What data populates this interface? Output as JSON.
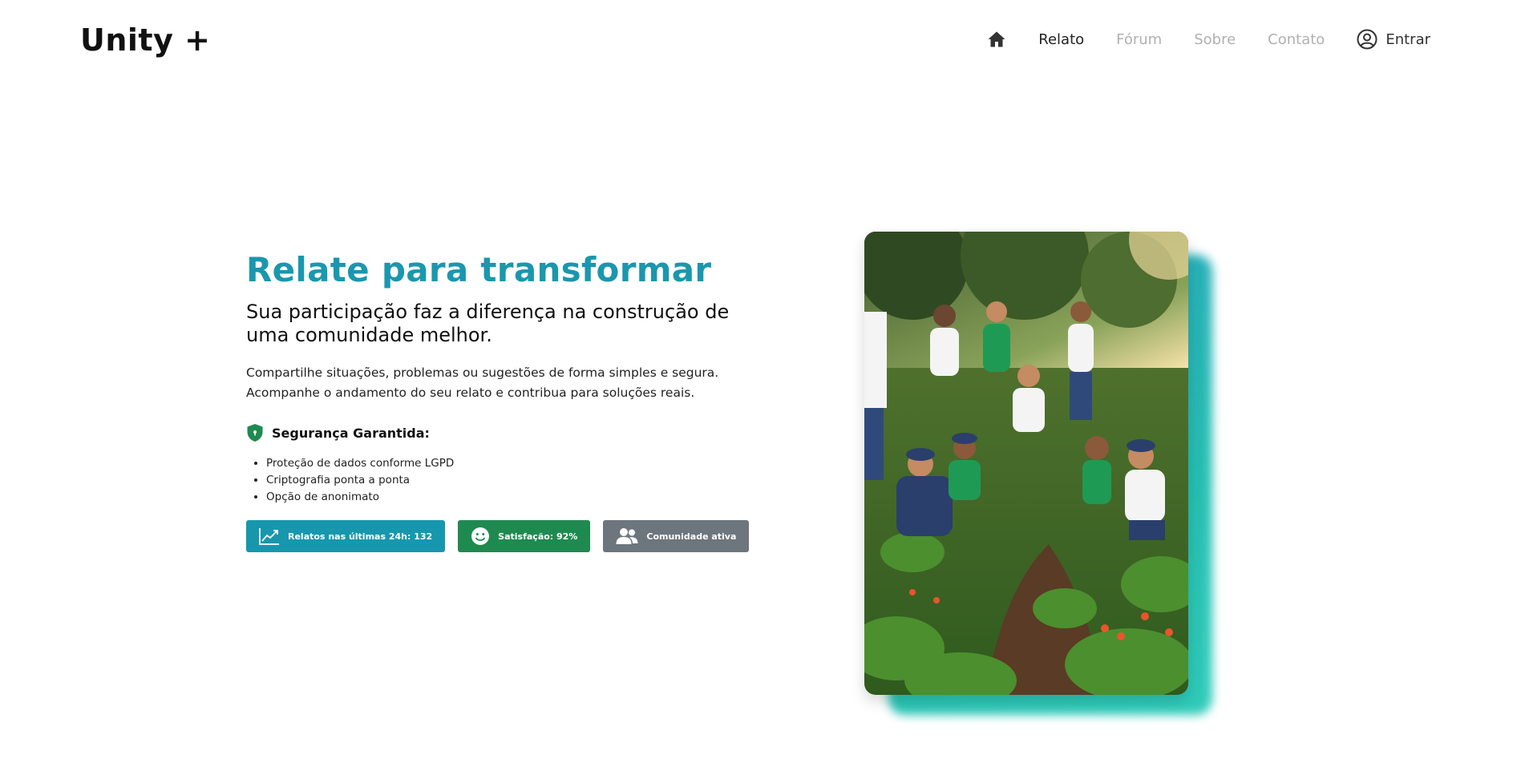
{
  "brand": "Unity +",
  "nav": {
    "home_icon": "home-icon",
    "items": [
      "Relato",
      "Fórum",
      "Sobre",
      "Contato"
    ],
    "active": "Relato",
    "login_label": "Entrar",
    "login_icon": "user-circle-icon"
  },
  "hero": {
    "title": "Relate para transformar",
    "subtitle": "Sua participação faz a diferença na construção de uma comunidade melhor.",
    "description": "Compartilhe situações, problemas ou sugestões de forma simples e segura. Acompanhe o andamento do seu relato e contribua para soluções reais.",
    "security": {
      "icon": "shield-icon",
      "heading": "Segurança Garantida:",
      "items": [
        "Proteção de dados conforme LGPD",
        "Criptografia ponta a ponta",
        "Opção de anonimato"
      ]
    },
    "badges": [
      {
        "icon": "trend-chart-icon",
        "label": "Relatos nas últimas 24h: 132",
        "color": "#1797ad"
      },
      {
        "icon": "smile-icon",
        "label": "Satisfação: 92%",
        "color": "#1f8a4f"
      },
      {
        "icon": "users-icon",
        "label": "Comunidade ativa",
        "color": "#6d757d"
      }
    ],
    "image_alt": "community-garden-photo"
  },
  "colors": {
    "accent": "#1a97ae",
    "green": "#1f8a4f",
    "gray": "#6d757d",
    "shadow_gradient": "#1bbcad"
  }
}
